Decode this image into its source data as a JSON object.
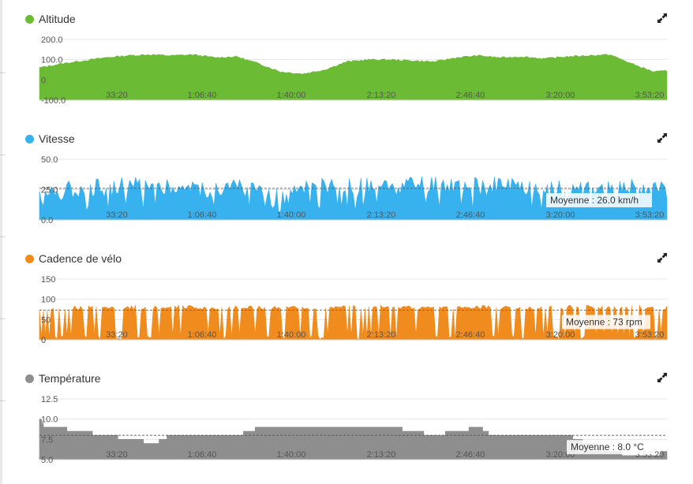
{
  "icons": {
    "expand": "expand-arrows-icon"
  },
  "panels": [
    {
      "id": "altitude",
      "title": "Altitude",
      "color": "#6cbb35",
      "y_ticks": [
        "200.0",
        "100.0",
        "0",
        "-100.0"
      ],
      "x_ticks": [
        "33:20",
        "1:06:40",
        "1:40:00",
        "2:13:20",
        "2:46:40",
        "3:20:00",
        "3:53:20"
      ],
      "average_label": ""
    },
    {
      "id": "speed",
      "title": "Vitesse",
      "color": "#37b2ef",
      "y_ticks": [
        "50.0",
        "25.0",
        "0.0"
      ],
      "x_ticks": [
        "33:20",
        "1:06:40",
        "1:40:00",
        "2:13:20",
        "2:46:40",
        "3:20:00",
        "3:53:20"
      ],
      "average_label": "Moyenne : 26.0 km/h"
    },
    {
      "id": "cadence",
      "title": "Cadence de vélo",
      "color": "#f08c1e",
      "y_ticks": [
        "150",
        "100",
        "50",
        "0"
      ],
      "x_ticks": [
        "33:20",
        "1:06:40",
        "1:40:00",
        "2:13:20",
        "2:46:40",
        "3:20:00",
        "3:53:20"
      ],
      "average_label": "Moyenne : 73 rpm"
    },
    {
      "id": "temperature",
      "title": "Température",
      "color": "#8e8e8e",
      "y_ticks": [
        "12.5",
        "10.0",
        "7.5",
        "5.0"
      ],
      "x_ticks": [
        "33:20",
        "1:06:40",
        "1:40:00",
        "2:13:20",
        "2:46:40",
        "3:20:00",
        "3:53:20"
      ],
      "average_label": "Moyenne : 8.0 °C"
    }
  ],
  "chart_data": [
    {
      "type": "area",
      "title": "Altitude",
      "x_ticks": [
        "33:20",
        "1:06:40",
        "1:40:00",
        "2:13:20",
        "2:46:40",
        "3:20:00",
        "3:53:20"
      ],
      "ylim": [
        -100,
        200
      ],
      "y_ticks": [
        200,
        100,
        0,
        -100
      ],
      "grid": true,
      "series": [
        {
          "name": "Altitude",
          "color": "#6cbb35",
          "x": [
            0,
            500,
            1000,
            1500,
            2000,
            2500,
            3000,
            3500,
            4000,
            4500,
            5000,
            5500,
            6000,
            6500,
            7000,
            7500,
            8000,
            8500,
            9000,
            9500,
            10000,
            10500,
            11000,
            11500,
            12000,
            12500,
            13000,
            13500,
            14000,
            14300
          ],
          "values": [
            60,
            80,
            95,
            110,
            120,
            125,
            120,
            125,
            110,
            115,
            80,
            40,
            30,
            50,
            90,
            100,
            100,
            95,
            90,
            110,
            120,
            110,
            115,
            105,
            115,
            120,
            125,
            80,
            40,
            45
          ]
        }
      ]
    },
    {
      "type": "area",
      "title": "Vitesse",
      "x_ticks": [
        "33:20",
        "1:06:40",
        "1:40:00",
        "2:13:20",
        "2:46:40",
        "3:20:00",
        "3:53:20"
      ],
      "ylim": [
        0,
        50
      ],
      "y_ticks": [
        50,
        25,
        0
      ],
      "average": 26.0,
      "series": [
        {
          "name": "Vitesse",
          "color": "#37b2ef",
          "x": [
            0,
            500,
            1000,
            1500,
            2000,
            2500,
            3000,
            3500,
            4000,
            4500,
            5000,
            5500,
            6000,
            6500,
            7000,
            7500,
            8000,
            8500,
            9000,
            9500,
            10000,
            10500,
            11000,
            11500,
            12000,
            12500,
            13000,
            13500,
            14000,
            14300
          ],
          "values": [
            22,
            24,
            27,
            26,
            28,
            29,
            27,
            26,
            25,
            27,
            23,
            18,
            24,
            27,
            26,
            27,
            26,
            28,
            29,
            28,
            27,
            28,
            26,
            27,
            25,
            27,
            26,
            28,
            26,
            24
          ]
        }
      ]
    },
    {
      "type": "area",
      "title": "Cadence de vélo",
      "x_ticks": [
        "33:20",
        "1:06:40",
        "1:40:00",
        "2:13:20",
        "2:46:40",
        "3:20:00",
        "3:53:20"
      ],
      "ylim": [
        0,
        150
      ],
      "y_ticks": [
        150,
        100,
        50,
        0
      ],
      "average": 73,
      "series": [
        {
          "name": "Cadence de vélo",
          "color": "#f08c1e",
          "x": [
            0,
            500,
            1000,
            1500,
            2000,
            2500,
            3000,
            3500,
            4000,
            4500,
            5000,
            5500,
            6000,
            6500,
            7000,
            7500,
            8000,
            8500,
            9000,
            9500,
            10000,
            10500,
            11000,
            11500,
            12000,
            12500,
            13000,
            13500,
            14000,
            14300
          ],
          "values": [
            75,
            80,
            78,
            82,
            80,
            79,
            81,
            80,
            78,
            80,
            79,
            80,
            78,
            81,
            80,
            82,
            79,
            80,
            78,
            80,
            81,
            79,
            80,
            78,
            80,
            82,
            79,
            80,
            81,
            78
          ]
        }
      ]
    },
    {
      "type": "area",
      "title": "Température",
      "x_ticks": [
        "33:20",
        "1:06:40",
        "1:40:00",
        "2:13:20",
        "2:46:40",
        "3:20:00",
        "3:53:20"
      ],
      "ylim": [
        5,
        12.5
      ],
      "y_ticks": [
        12.5,
        10,
        7.5,
        5
      ],
      "average": 8.0,
      "series": [
        {
          "name": "Température",
          "color": "#8e8e8e",
          "x": [
            0,
            100,
            300,
            1500,
            2600,
            3000,
            4500,
            5000,
            7000,
            8000,
            9000,
            10000,
            10300,
            11000,
            11500,
            12000,
            12500,
            13000,
            13500,
            14000,
            14300
          ],
          "values": [
            10,
            9,
            9,
            8,
            7,
            8,
            8,
            9,
            9,
            9,
            8,
            9,
            8,
            8,
            8,
            8,
            7,
            6,
            5.5,
            5.5,
            6
          ]
        }
      ]
    }
  ]
}
